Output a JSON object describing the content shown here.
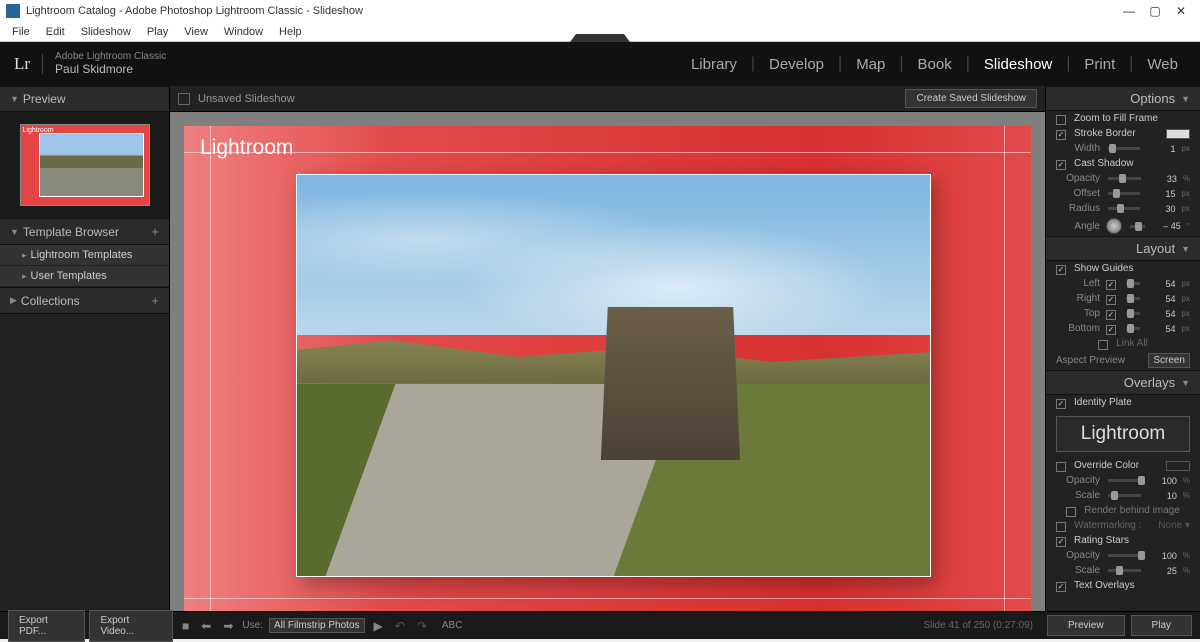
{
  "window": {
    "title": "Lightroom Catalog - Adobe Photoshop Lightroom Classic - Slideshow",
    "minimize": "—",
    "maximize": "▢",
    "close": "✕"
  },
  "menu": [
    "File",
    "Edit",
    "Slideshow",
    "Play",
    "View",
    "Window",
    "Help"
  ],
  "identity": {
    "logo": "Lr",
    "product": "Adobe Lightroom Classic",
    "user": "Paul Skidmore"
  },
  "modules": [
    "Library",
    "Develop",
    "Map",
    "Book",
    "Slideshow",
    "Print",
    "Web"
  ],
  "activeModule": "Slideshow",
  "left": {
    "preview": "Preview",
    "templateBrowser": "Template Browser",
    "lrTemplates": "Lightroom Templates",
    "userTemplates": "User Templates",
    "collections": "Collections"
  },
  "centerTop": {
    "unsaved": "Unsaved Slideshow",
    "createSaved": "Create Saved Slideshow"
  },
  "slide": {
    "identityText": "Lightroom"
  },
  "right": {
    "options": "Options",
    "zoomToFill": "Zoom to Fill Frame",
    "strokeBorder": "Stroke Border",
    "width": "Width",
    "widthVal": "1",
    "castShadow": "Cast Shadow",
    "opacity": "Opacity",
    "opacityVal": "33",
    "offset": "Offset",
    "offsetVal": "15",
    "radius": "Radius",
    "radiusVal": "30",
    "angle": "Angle",
    "angleVal": "– 45",
    "layout": "Layout",
    "showGuides": "Show Guides",
    "left_l": "Left",
    "leftVal": "54",
    "right_l": "Right",
    "rightVal": "54",
    "top_l": "Top",
    "topVal": "54",
    "bottom_l": "Bottom",
    "bottomVal": "54",
    "linkAll": "Link All",
    "aspectPreview": "Aspect Preview",
    "screen": "Screen",
    "overlays": "Overlays",
    "identityPlate": "Identity Plate",
    "identityBox": "Lightroom",
    "overrideColor": "Override Color",
    "idOpacity": "Opacity",
    "idOpacityVal": "100",
    "scale": "Scale",
    "scaleVal": "10",
    "renderBehind": "Render behind image",
    "watermarking": "Watermarking :",
    "watermarkNone": "None ▾",
    "ratingStars": "Rating Stars",
    "rsOpacity": "Opacity",
    "rsOpacityVal": "100",
    "rsScale": "Scale",
    "rsScaleVal": "25",
    "textOverlays": "Text Overlays",
    "pct": "%",
    "px": "px",
    "deg": "°"
  },
  "bottom": {
    "exportPdf": "Export PDF...",
    "exportVideo": "Export Video...",
    "use": "Use:",
    "filmstrip": "All Filmstrip Photos",
    "abc": "ABC",
    "counter": "Slide 41 of 250 (0:27:09)",
    "preview": "Preview",
    "play": "Play"
  }
}
